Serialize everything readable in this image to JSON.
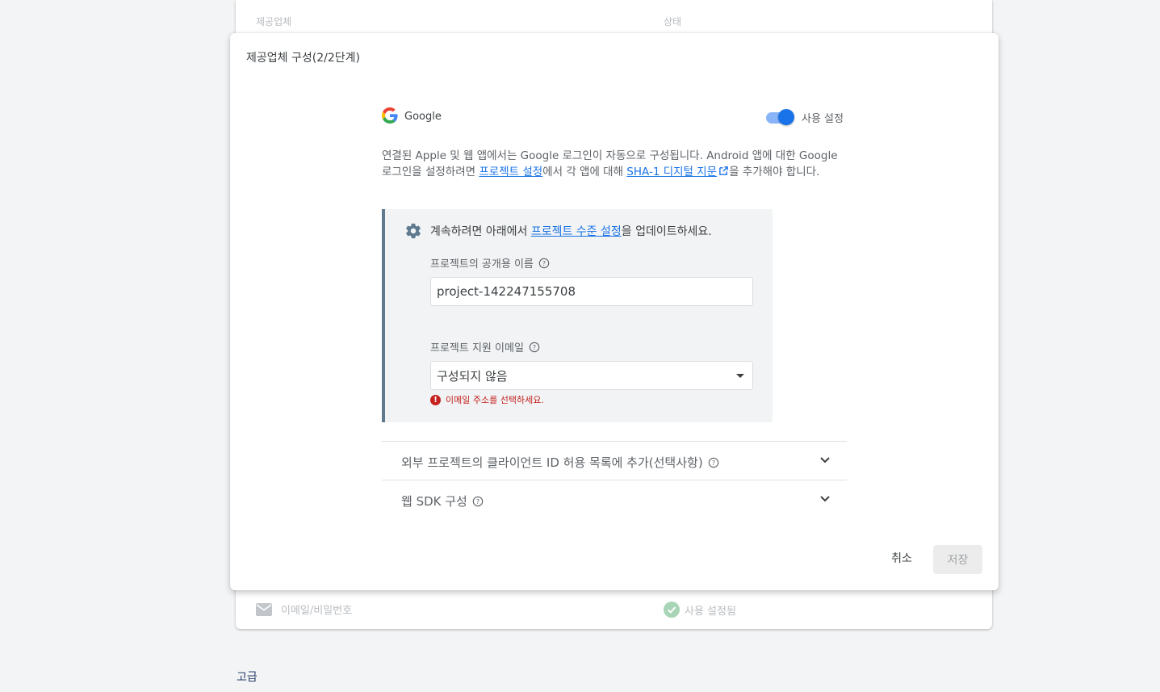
{
  "background": {
    "col_provider": "제공업체",
    "col_status": "상태",
    "row_provider": "이메일/비밀번호",
    "row_status": "사용 설정됨",
    "section_title": "고급"
  },
  "dialog": {
    "title": "제공업체 구성(2/2단계)",
    "provider_name": "Google",
    "toggle_label": "사용 설정",
    "toggle_on": true,
    "desc_part1": "연결된 Apple 및 웹 앱에서는 Google 로그인이 자동으로 구성됩니다. Android 앱에 대한 Google 로그인을 설정하려면 ",
    "desc_link1": "프로젝트 설정",
    "desc_part2": "에서 각 앱에 대해 ",
    "desc_link2": "SHA-1 디지털 지문",
    "desc_part3": "을 추가해야 합니다.",
    "info_part1": "계속하려면 아래에서 ",
    "info_link": "프로젝트 수준 설정",
    "info_part2": "을 업데이트하세요.",
    "public_name_label": "프로젝트의 공개용 이름",
    "public_name_value": "project-142247155708",
    "support_email_label": "프로젝트 지원 이메일",
    "support_email_value": "구성되지 않음",
    "error_text": "이메일 주소를 선택하세요.",
    "expander1_label": "외부 프로젝트의 클라이언트 ID 허용 목록에 추가(선택사항)",
    "expander2_label": "웹 SDK 구성",
    "cancel_label": "취소",
    "save_label": "저장"
  },
  "colors": {
    "accent": "#1a73e8",
    "error": "#c5221f",
    "success": "#34a853"
  }
}
